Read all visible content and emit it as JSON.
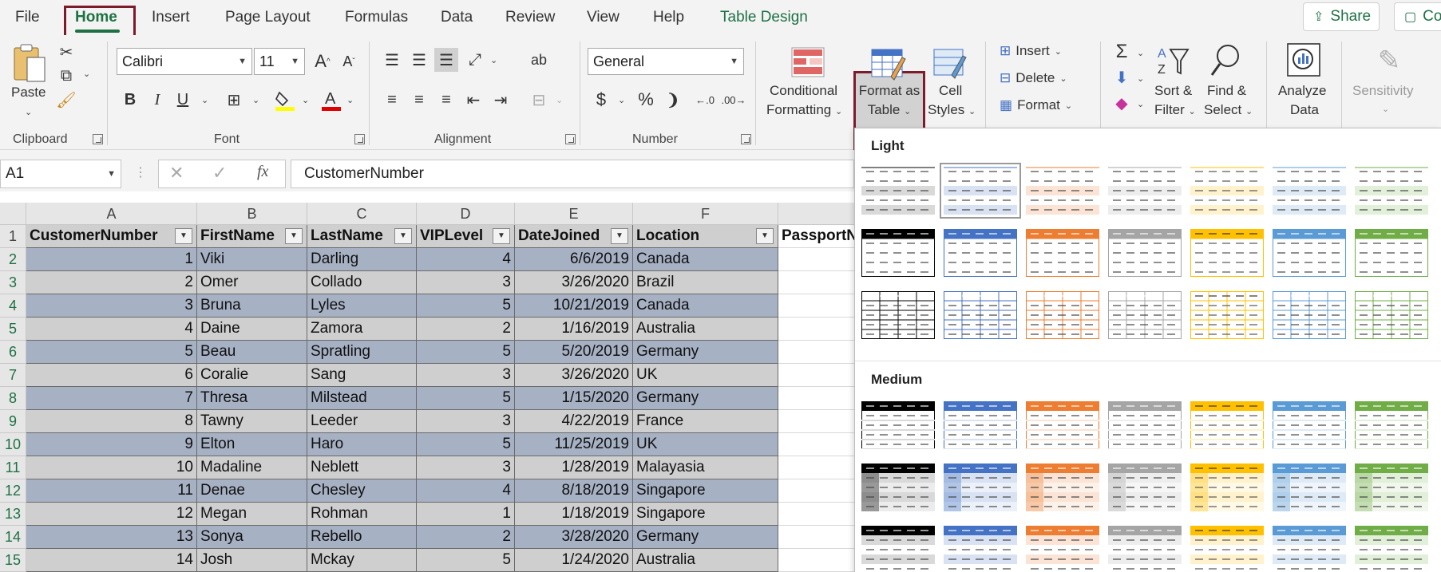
{
  "menu": {
    "tabs": [
      "File",
      "Home",
      "Insert",
      "Page Layout",
      "Formulas",
      "Data",
      "Review",
      "View",
      "Help",
      "Table Design"
    ],
    "share_label": "Share",
    "comments_label": "Co"
  },
  "ribbon": {
    "clipboard": {
      "paste": "Paste",
      "label": "Clipboard"
    },
    "font": {
      "name": "Calibri",
      "size": "11",
      "grow": "A",
      "shrink": "A",
      "bold": "B",
      "italic": "I",
      "underline": "U",
      "label": "Font"
    },
    "alignment": {
      "label": "Alignment",
      "wrap": "ab"
    },
    "number": {
      "format": "General",
      "currency": "$",
      "percent": "%",
      "comma": "❩",
      "label": "Number"
    },
    "styles": {
      "conditional_line1": "Conditional",
      "conditional_line2": "Formatting",
      "format_table_line1": "Format as",
      "format_table_line2": "Table",
      "cell_styles_line1": "Cell",
      "cell_styles_line2": "Styles"
    },
    "cells": {
      "insert": "Insert",
      "delete": "Delete",
      "format": "Format"
    },
    "editing": {
      "sort_line1": "Sort &",
      "sort_line2": "Filter",
      "find_line1": "Find &",
      "find_line2": "Select"
    },
    "analyze": {
      "line1": "Analyze",
      "line2": "Data"
    },
    "sensitivity": {
      "label": "Sensitivity"
    },
    "colors": {
      "highlight": "#ffff00",
      "font_color": "#e00000"
    }
  },
  "formula_bar": {
    "name_box": "A1",
    "fx": "fx",
    "value": "CustomerNumber"
  },
  "grid": {
    "columns": [
      "A",
      "B",
      "C",
      "D",
      "E",
      "F",
      ""
    ],
    "headers": [
      "CustomerNumber",
      "FirstName",
      "LastName",
      "VIPLevel",
      "DateJoined",
      "Location",
      "PassportN"
    ],
    "row_numbers": [
      "1",
      "2",
      "3",
      "4",
      "5",
      "6",
      "7",
      "8",
      "9",
      "10",
      "11",
      "12",
      "13",
      "14",
      "15"
    ],
    "rows": [
      [
        "1",
        "Viki",
        "Darling",
        "4",
        "6/6/2019",
        "Canada"
      ],
      [
        "2",
        "Omer",
        "Collado",
        "3",
        "3/26/2020",
        "Brazil"
      ],
      [
        "3",
        "Bruna",
        "Lyles",
        "5",
        "10/21/2019",
        "Canada"
      ],
      [
        "4",
        "Daine",
        "Zamora",
        "2",
        "1/16/2019",
        "Australia"
      ],
      [
        "5",
        "Beau",
        "Spratling",
        "5",
        "5/20/2019",
        "Germany"
      ],
      [
        "6",
        "Coralie",
        "Sang",
        "3",
        "3/26/2020",
        "UK"
      ],
      [
        "7",
        "Thresa",
        "Milstead",
        "5",
        "1/15/2020",
        "Germany"
      ],
      [
        "8",
        "Tawny",
        "Leeder",
        "3",
        "4/22/2019",
        "France"
      ],
      [
        "9",
        "Elton",
        "Haro",
        "5",
        "11/25/2019",
        "UK"
      ],
      [
        "10",
        "Madaline",
        "Neblett",
        "3",
        "1/28/2019",
        "Malayasia"
      ],
      [
        "11",
        "Denae",
        "Chesley",
        "4",
        "8/18/2019",
        "Singapore"
      ],
      [
        "12",
        "Megan",
        "Rohman",
        "1",
        "1/18/2019",
        "Singapore"
      ],
      [
        "13",
        "Sonya",
        "Rebello",
        "2",
        "3/28/2020",
        "Germany"
      ],
      [
        "14",
        "Josh",
        "Mckay",
        "5",
        "1/24/2020",
        "Australia"
      ]
    ]
  },
  "gallery": {
    "light_label": "Light",
    "medium_label": "Medium",
    "palette": [
      "#000000",
      "#4472c4",
      "#ed7d31",
      "#a5a5a5",
      "#ffc000",
      "#5b9bd5",
      "#70ad47"
    ],
    "tints": [
      "#d9d9d9",
      "#d9e2f3",
      "#fbe4d5",
      "#ededed",
      "#fff2cc",
      "#deebf6",
      "#e2efd9"
    ]
  }
}
